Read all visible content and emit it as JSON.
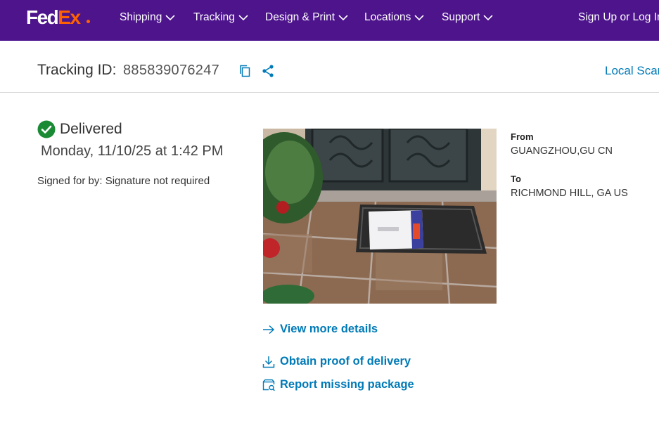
{
  "brand": {
    "logo_fed": "Fed",
    "logo_ex": "Ex",
    "primary": "#4d148c",
    "accent": "#ff6200",
    "link": "#007ab7"
  },
  "nav": {
    "items": [
      {
        "label": "Shipping"
      },
      {
        "label": "Tracking"
      },
      {
        "label": "Design & Print"
      },
      {
        "label": "Locations"
      },
      {
        "label": "Support"
      }
    ],
    "signin": "Sign Up or Log In"
  },
  "tracking": {
    "label": "Tracking ID:",
    "id": "885839076247",
    "local_scan": "Local Scan"
  },
  "status": {
    "state": "Delivered",
    "datetime": "Monday, 11/10/25 at 1:42 PM",
    "signed": "Signed for by: Signature not required",
    "color": "#1a8a34"
  },
  "route": {
    "from_label": "From",
    "from": "GUANGZHOU,GU CN",
    "to_label": "To",
    "to": "RICHMOND HILL, GA US"
  },
  "links": {
    "details": "View more details",
    "proof": "Obtain proof of delivery",
    "missing": "Report missing package"
  },
  "icons": [
    "copy-icon",
    "share-icon",
    "check-circle-icon",
    "arrow-right-icon",
    "download-icon",
    "report-package-icon",
    "chevron-down-icon"
  ]
}
